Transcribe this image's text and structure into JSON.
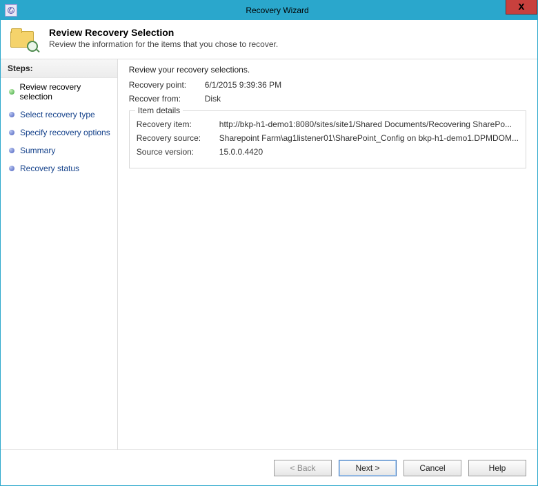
{
  "titlebar": {
    "title": "Recovery Wizard"
  },
  "header": {
    "title": "Review Recovery Selection",
    "subtitle": "Review the information for the items that you chose to recover."
  },
  "sidebar": {
    "title": "Steps:",
    "items": [
      {
        "label": "Review recovery selection",
        "current": true
      },
      {
        "label": "Select recovery type",
        "current": false
      },
      {
        "label": "Specify recovery options",
        "current": false
      },
      {
        "label": "Summary",
        "current": false
      },
      {
        "label": "Recovery status",
        "current": false
      }
    ]
  },
  "content": {
    "intro": "Review your recovery selections.",
    "recovery_point_label": "Recovery point:",
    "recovery_point_value": "6/1/2015 9:39:36 PM",
    "recover_from_label": "Recover from:",
    "recover_from_value": "Disk",
    "item_details": {
      "legend": "Item details",
      "recovery_item_label": "Recovery item:",
      "recovery_item_value": "http://bkp-h1-demo1:8080/sites/site1/Shared Documents/Recovering SharePo...",
      "recovery_source_label": "Recovery source:",
      "recovery_source_value": "Sharepoint Farm\\ag1listener01\\SharePoint_Config on bkp-h1-demo1.DPMDOM...",
      "source_version_label": "Source version:",
      "source_version_value": "15.0.0.4420"
    }
  },
  "footer": {
    "back": "< Back",
    "next": "Next >",
    "cancel": "Cancel",
    "help": "Help"
  }
}
